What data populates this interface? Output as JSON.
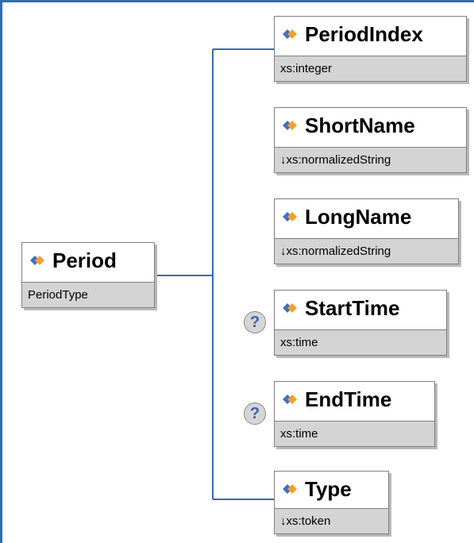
{
  "root": {
    "name": "Period",
    "type": "PeriodType"
  },
  "children": [
    {
      "name": "PeriodIndex",
      "type": "xs:integer"
    },
    {
      "name": "ShortName",
      "type": "↓xs:normalizedString"
    },
    {
      "name": "LongName",
      "type": "↓xs:normalizedString"
    },
    {
      "name": "StartTime",
      "type": "xs:time",
      "optional": "?"
    },
    {
      "name": "EndTime",
      "type": "xs:time",
      "optional": "?"
    },
    {
      "name": "Type",
      "type": "↓xs:token"
    }
  ],
  "colors": {
    "frame": "#2f6db5",
    "connector": "#2f6db5",
    "footer": "#d4d4d4",
    "icon_blue": "#3f6fc0",
    "icon_orange": "#f0a030"
  }
}
